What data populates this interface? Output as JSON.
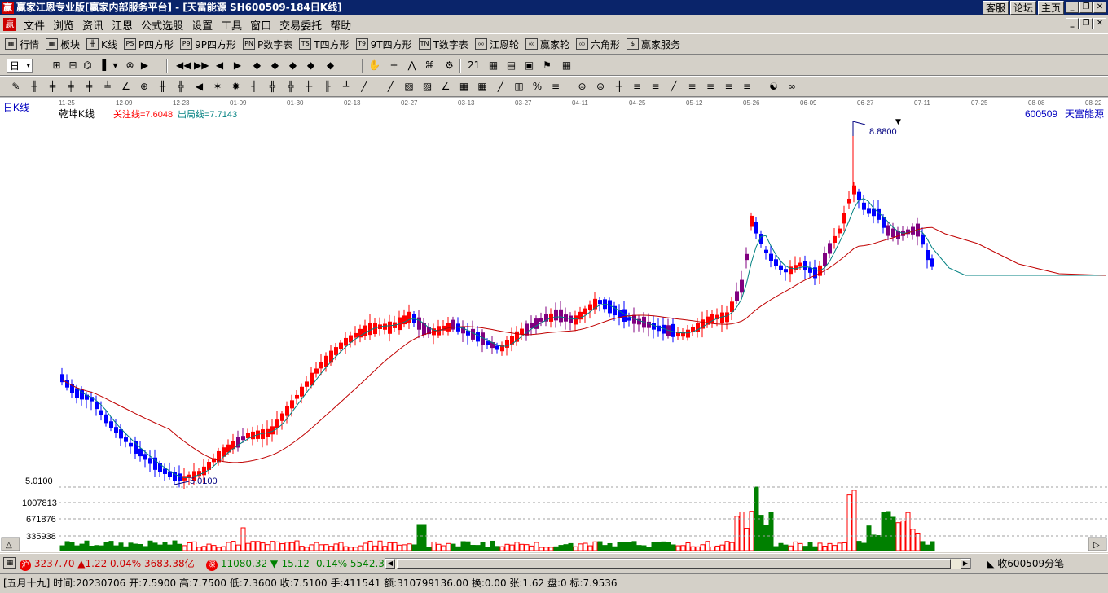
{
  "window": {
    "title": "赢家江恩专业版[赢家内部服务平台] - [天富能源  SH600509-184日K线]",
    "logo": "赢",
    "links": [
      "客服",
      "论坛",
      "主页"
    ]
  },
  "menu": [
    "文件",
    "浏览",
    "资讯",
    "江恩",
    "公式选股",
    "设置",
    "工具",
    "窗口",
    "交易委托",
    "帮助"
  ],
  "toolbar1": [
    {
      "icon": "grid-icon",
      "glyph": "▦",
      "label": "行情"
    },
    {
      "icon": "sector-icon",
      "glyph": "▦",
      "label": "板块"
    },
    {
      "icon": "kline-icon",
      "glyph": "╫",
      "label": "K线"
    },
    {
      "icon": "p-square-icon",
      "glyph": "PS",
      "label": "P四方形"
    },
    {
      "icon": "9p-square-icon",
      "glyph": "P9",
      "label": "9P四方形"
    },
    {
      "icon": "p-number-icon",
      "glyph": "PN",
      "label": "P数字表"
    },
    {
      "icon": "t-square-icon",
      "glyph": "TS",
      "label": "T四方形"
    },
    {
      "icon": "9t-square-icon",
      "glyph": "T9",
      "label": "9T四方形"
    },
    {
      "icon": "t-number-icon",
      "glyph": "TN",
      "label": "T数字表"
    },
    {
      "icon": "gann-wheel-icon",
      "glyph": "◎",
      "label": "江恩轮"
    },
    {
      "icon": "winner-wheel-icon",
      "glyph": "◎",
      "label": "赢家轮"
    },
    {
      "icon": "hexagon-icon",
      "glyph": "◎",
      "label": "六角形"
    },
    {
      "icon": "dollar-icon",
      "glyph": "$",
      "label": "赢家服务"
    }
  ],
  "toolbar2": {
    "period": "日",
    "icons": [
      "▾",
      "⊞",
      "⊟",
      "⌬",
      "▐",
      "▾",
      "⊗",
      "▶",
      "◀◀",
      "▶▶",
      "◀",
      "▶",
      "◆",
      "◆",
      "◆",
      "◆",
      "◆",
      "✋",
      "+",
      "⋀",
      "⌘",
      "⚙",
      "21",
      "▦",
      "▤",
      "▣",
      "⚑",
      "▦"
    ],
    "icon_names": [
      "period-dropdown-icon",
      "zoom-in-icon",
      "zoom-out-icon",
      "kline-type-icon",
      "bar-type-icon",
      "type-dropdown-icon",
      "no-indicator-icon",
      "flag-icon",
      "first-icon",
      "last-icon",
      "prev-icon",
      "next-icon",
      "diamond-up-icon",
      "diamond-down-icon",
      "diamond-left-icon",
      "diamond-right-icon",
      "diamond-center-icon",
      "pan-hand-icon",
      "crosshair-icon",
      "line-draw-icon",
      "gann-icon",
      "gear-icon",
      "calendar-icon",
      "calc-icon",
      "table-icon",
      "save-icon",
      "alert-icon",
      "trade-icon"
    ]
  },
  "toolbar3_icons": [
    "✎",
    "╫",
    "╪",
    "╪",
    "╪",
    "╧",
    "∠",
    "⊕",
    "╫",
    "╬",
    "◀",
    "✶",
    "✹",
    "┤",
    "╬",
    "╬",
    "╫",
    "╟",
    "╨",
    "╱",
    "╱",
    "▨",
    "▨",
    "∠",
    "▦",
    "▦",
    "╱",
    "▥",
    "%",
    "≡",
    "⊜",
    "⊜",
    "╫",
    "≡",
    "≡",
    "╱",
    "≡",
    "≡",
    "≡",
    "≡",
    "☯",
    "∞"
  ],
  "chart": {
    "period_label": "日K线",
    "indicator_name": "乾坤K线",
    "guan_zhu": "关注线=7.6048",
    "chu_ju": "出局线=7.7143",
    "code": "600509",
    "name": "天富能源",
    "high_label": "8.8800",
    "low_label": "5.0100",
    "vol_axis": [
      "5.0100",
      "1007813",
      "671876",
      "335938"
    ],
    "dates": [
      "11-25",
      "12-09",
      "12-23",
      "01-09",
      "01-30",
      "02-13",
      "02-27",
      "03-13",
      "03-27",
      "04-11",
      "04-25",
      "05-12",
      "05-26",
      "06-09",
      "06-27",
      "07-11",
      "07-25",
      "08-08",
      "08-22"
    ],
    "colors": {
      "up": "#ff0000",
      "down": "#0000ff",
      "purple": "#800080",
      "vol_up": "#ff0000",
      "vol_down": "#008000",
      "ma_short": "#008080",
      "ma_long": "#c00000"
    }
  },
  "status": {
    "sh_icon": "沪",
    "sh_value": "3237.70",
    "sh_change": "▲1.22 0.04% 3683.38亿",
    "sz_icon": "深",
    "sz_value": "11080.32",
    "sz_change": "▼-15.12 -0.14% 5542.3",
    "right": "收600509分笔"
  },
  "info": "[五月十九] 时间:20230706 开:7.5900 高:7.7500 低:7.3600 收:7.5100 手:411541 额:310799136.00 换:0.00 张:1.62 盘:0 标:7.9536"
}
